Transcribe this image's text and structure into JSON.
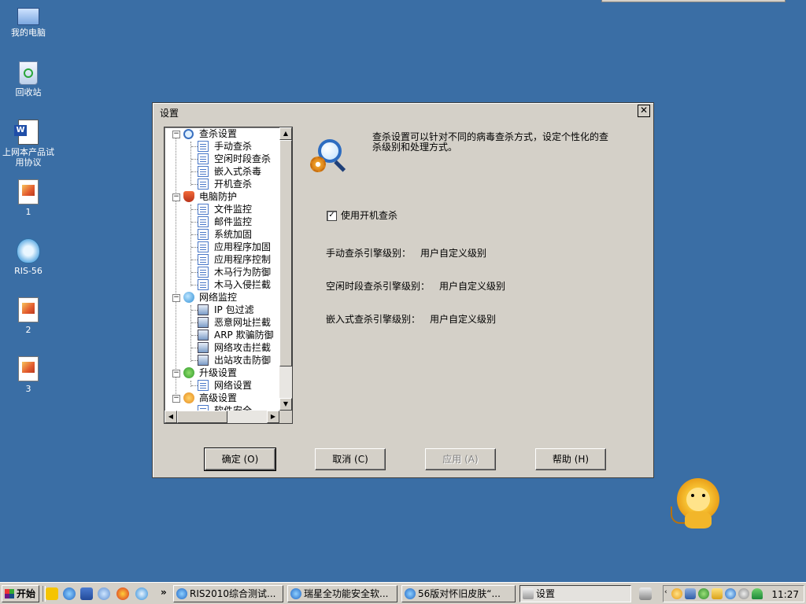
{
  "desktop": {
    "icons": [
      {
        "label": "我的电脑",
        "icon": "my-computer-icon"
      },
      {
        "label": "回收站",
        "icon": "recycle-bin-icon"
      },
      {
        "label": "上网本产品试用协议",
        "icon": "word-document-icon"
      },
      {
        "label": "1",
        "icon": "image-file-icon"
      },
      {
        "label": "RIS-56",
        "icon": "rising-shield-icon"
      },
      {
        "label": "2",
        "icon": "image-file-icon"
      },
      {
        "label": "3",
        "icon": "image-file-icon"
      }
    ]
  },
  "dialog": {
    "title": "设置",
    "close_label": "✕",
    "tree": {
      "groups": [
        {
          "label": "查杀设置",
          "icon": "scan-settings-icon",
          "children": [
            "手动查杀",
            "空闲时段查杀",
            "嵌入式杀毒",
            "开机查杀"
          ]
        },
        {
          "label": "电脑防护",
          "icon": "pc-protection-icon",
          "children": [
            "文件监控",
            "邮件监控",
            "系统加固",
            "应用程序加固",
            "应用程序控制",
            "木马行为防御",
            "木马入侵拦截"
          ]
        },
        {
          "label": "网络监控",
          "icon": "network-monitor-icon",
          "children": [
            "IP 包过滤",
            "恶意网址拦截",
            "ARP 欺骗防御",
            "网络攻击拦截",
            "出站攻击防御"
          ]
        },
        {
          "label": "升级设置",
          "icon": "upgrade-settings-icon",
          "children": [
            "网络设置"
          ]
        },
        {
          "label": "高级设置",
          "icon": "advanced-settings-icon",
          "children": [
            "软件安全"
          ]
        }
      ]
    },
    "description": "查杀设置可以针对不同的病毒查杀方式，设定个性化的查杀级别和处理方式。",
    "startup_scan": {
      "label": "使用开机查杀",
      "checked": true
    },
    "levels": [
      {
        "label": "手动查杀引擎级别：",
        "value": "用户自定义级别"
      },
      {
        "label": "空闲时段查杀引擎级别：",
        "value": "用户自定义级别"
      },
      {
        "label": "嵌入式查杀引擎级别：",
        "value": "用户自定义级别"
      }
    ],
    "buttons": {
      "ok": "确定 (O)",
      "cancel": "取消 (C)",
      "apply": "应用 (A)",
      "help": "帮助 (H)"
    }
  },
  "taskbar": {
    "start_label": "开始",
    "more_label": "»",
    "tasks": [
      {
        "label": "RIS2010综合测试...",
        "active": false
      },
      {
        "label": "瑞星全功能安全软...",
        "active": false
      },
      {
        "label": "56版对怀旧皮肤“...",
        "active": false
      },
      {
        "label": "设置",
        "active": true
      }
    ],
    "clock": "11:27"
  },
  "colors": {
    "desktop": "#3a6ea5",
    "chrome": "#d4d0c8"
  }
}
